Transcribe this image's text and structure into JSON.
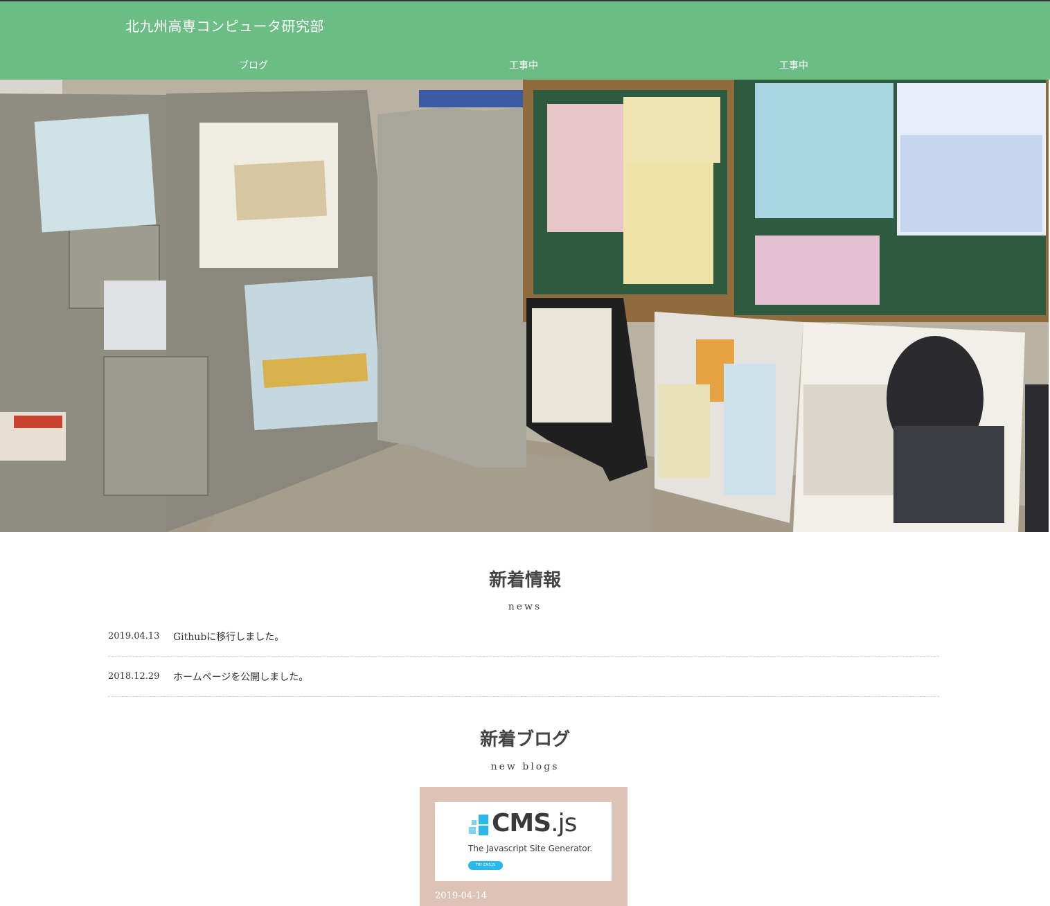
{
  "header": {
    "site_title": "北九州高専コンピュータ研究部",
    "nav": [
      {
        "label": "ブログ"
      },
      {
        "label": "工事中"
      },
      {
        "label": "工事中"
      }
    ],
    "background_color": "#6cbd85"
  },
  "news": {
    "title": "新着情報",
    "subtitle": "news",
    "items": [
      {
        "date": "2019.04.13",
        "text": "Githubに移行しました。"
      },
      {
        "date": "2018.12.29",
        "text": "ホームページを公開しました。"
      }
    ]
  },
  "blogs": {
    "title": "新着ブログ",
    "subtitle": "new blogs",
    "cards": [
      {
        "thumb_logo": "CMS",
        "thumb_logo_ext": ".js",
        "thumb_tagline": "The Javascript Site Generator.",
        "thumb_button": "TRY CMS.JS",
        "date": "2019-04-14"
      }
    ],
    "card_color": "#dcc3b6"
  }
}
